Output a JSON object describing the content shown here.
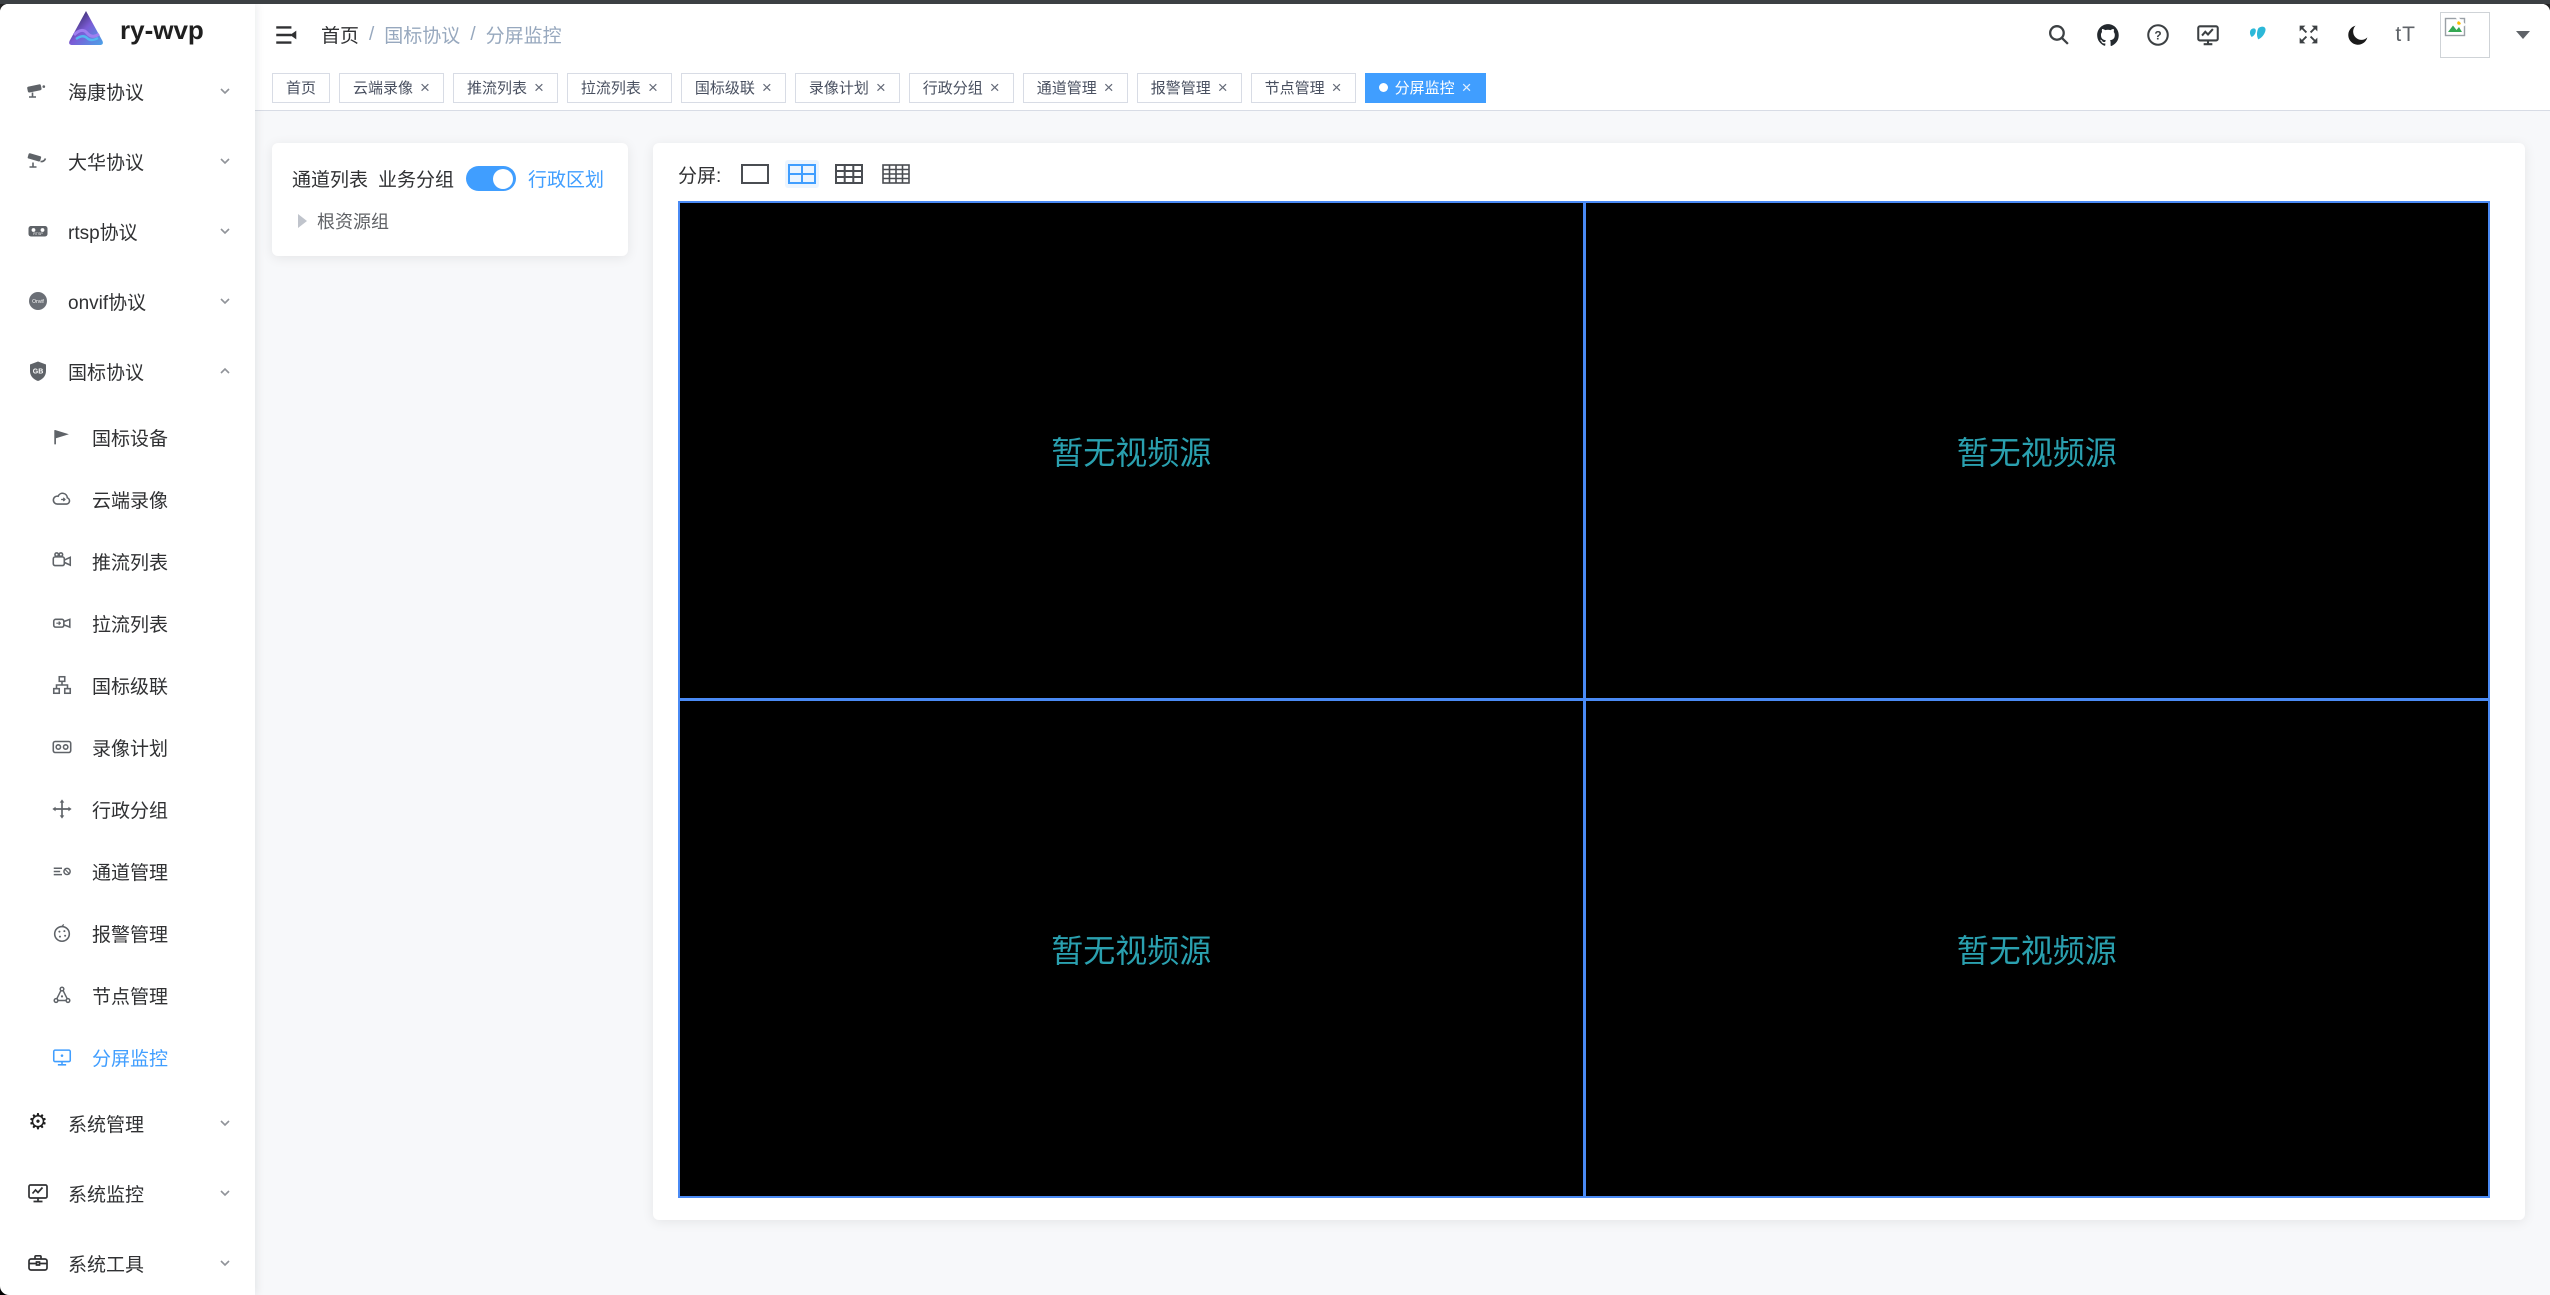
{
  "app": {
    "logo_title": "ry-wvp"
  },
  "navbar": {
    "breadcrumb": {
      "items": [
        "首页",
        "国标协议",
        "分屏监控"
      ],
      "separator": "/"
    },
    "font_size_label": "tT"
  },
  "tags_view": {
    "close_glyph": "×",
    "tags": [
      {
        "label": "首页",
        "closable": false,
        "active": false
      },
      {
        "label": "云端录像",
        "closable": true,
        "active": false
      },
      {
        "label": "推流列表",
        "closable": true,
        "active": false
      },
      {
        "label": "拉流列表",
        "closable": true,
        "active": false
      },
      {
        "label": "国标级联",
        "closable": true,
        "active": false
      },
      {
        "label": "录像计划",
        "closable": true,
        "active": false
      },
      {
        "label": "行政分组",
        "closable": true,
        "active": false
      },
      {
        "label": "通道管理",
        "closable": true,
        "active": false
      },
      {
        "label": "报警管理",
        "closable": true,
        "active": false
      },
      {
        "label": "节点管理",
        "closable": true,
        "active": false
      },
      {
        "label": "分屏监控",
        "closable": true,
        "active": true
      }
    ]
  },
  "sidebar": {
    "groups_top": [
      {
        "label": "海康协议"
      },
      {
        "label": "大华协议"
      },
      {
        "label": "rtsp协议"
      },
      {
        "label": "onvif协议"
      }
    ],
    "gb_group": {
      "label": "国标协议",
      "expanded": true
    },
    "gb_children": [
      {
        "label": "国标设备"
      },
      {
        "label": "云端录像"
      },
      {
        "label": "推流列表"
      },
      {
        "label": "拉流列表"
      },
      {
        "label": "国标级联"
      },
      {
        "label": "录像计划"
      },
      {
        "label": "行政分组"
      },
      {
        "label": "通道管理"
      },
      {
        "label": "报警管理"
      },
      {
        "label": "节点管理"
      },
      {
        "label": "分屏监控",
        "active": true
      }
    ],
    "groups_bottom": [
      {
        "label": "系统管理"
      },
      {
        "label": "系统监控"
      },
      {
        "label": "系统工具"
      }
    ]
  },
  "channel_panel": {
    "title": "通道列表",
    "mode_left": "业务分组",
    "mode_right": "行政区划",
    "toggle_on": true,
    "tree_root": "根资源组"
  },
  "monitor": {
    "split_label": "分屏:",
    "split_options": [
      "1",
      "4",
      "9",
      "16"
    ],
    "active_split": "4",
    "cells": [
      {
        "text": "暂无视频源"
      },
      {
        "text": "暂无视频源"
      },
      {
        "text": "暂无视频源"
      },
      {
        "text": "暂无视频源"
      }
    ]
  },
  "colors": {
    "primary": "#409eff",
    "grid_border": "#4a8af4",
    "no_video_text": "#2aa0af",
    "tag_active_bg": "#409eff"
  }
}
